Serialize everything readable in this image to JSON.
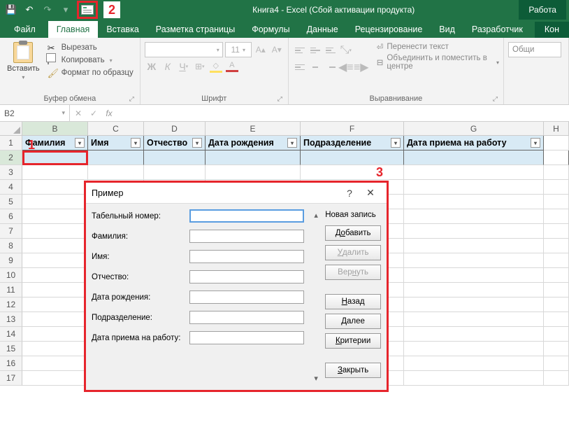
{
  "annotations": {
    "one": "1",
    "two": "2",
    "three": "3"
  },
  "title": "Книга4 - Excel (Сбой активации продукта)",
  "right_tab_title": "Работа",
  "right_tab_sub": "Кон",
  "tabs": {
    "file": "Файл",
    "home": "Главная",
    "insert": "Вставка",
    "layout": "Разметка страницы",
    "formulas": "Формулы",
    "data": "Данные",
    "review": "Рецензирование",
    "view": "Вид",
    "developer": "Разработчик"
  },
  "ribbon": {
    "clipboard": {
      "paste": "Вставить",
      "cut": "Вырезать",
      "copy": "Копировать",
      "format_painter": "Формат по образцу",
      "group": "Буфер обмена"
    },
    "font": {
      "size": "11",
      "group": "Шрифт"
    },
    "alignment": {
      "wrap": "Перенести текст",
      "merge": "Объединить и поместить в центре",
      "group": "Выравнивание"
    },
    "number": {
      "format": "Общи"
    }
  },
  "namebox": "B2",
  "columns": [
    "B",
    "C",
    "D",
    "E",
    "F",
    "G",
    "H"
  ],
  "table_headers": [
    "Фамилия",
    "Имя",
    "Отчество",
    "Дата рождения",
    "Подразделение",
    "Дата приема на работу"
  ],
  "dialog": {
    "title": "Пример",
    "fields": {
      "tabnum": "Табельный номер:",
      "lastname": "Фамилия:",
      "firstname": "Имя:",
      "patronymic": "Отчество:",
      "birthdate": "Дата рождения:",
      "department": "Подразделение:",
      "hiredate": "Дата приема на работу:"
    },
    "new_record": "Новая запись",
    "buttons": {
      "add_pre": "Д",
      "add_u": "о",
      "add_post": "бавить",
      "delete_u": "У",
      "delete_post": "далить",
      "return_pre": "Вер",
      "return_u": "н",
      "return_post": "уть",
      "back_u": "Н",
      "back_post": "азад",
      "next_u": "Д",
      "next_post": "алее",
      "criteria_u": "К",
      "criteria_post": "ритерии",
      "close_u": "З",
      "close_post": "акрыть"
    }
  }
}
